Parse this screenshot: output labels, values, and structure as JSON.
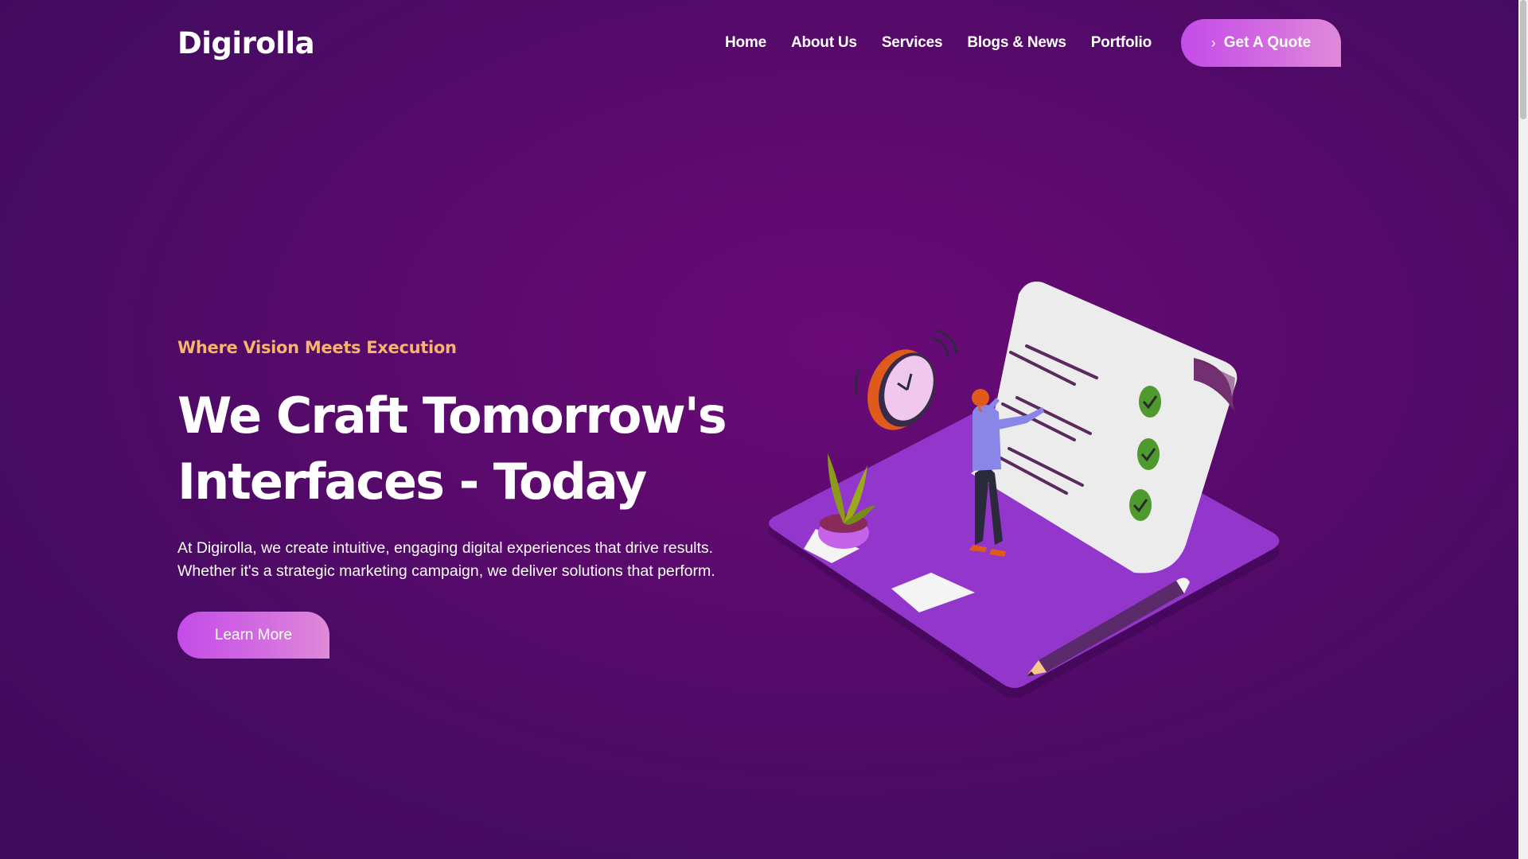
{
  "header": {
    "logo": "Digirolla",
    "nav": [
      "Home",
      "About Us",
      "Services",
      "Blogs & News",
      "Portfolio"
    ],
    "cta_label": "Get A Quote"
  },
  "hero": {
    "tagline": "Where Vision Meets Execution",
    "headline_line1": "We Craft Tomorrow's",
    "headline_line2": "Interfaces - Today",
    "description": "At Digirolla, we create intuitive, engaging digital experiences that drive results. Whether it's a strategic marketing campaign, we deliver solutions that perform.",
    "button_label": "Learn More"
  },
  "colors": {
    "background": "#5a0a6c",
    "accent_gradient_start": "#c44ce8",
    "accent_gradient_end": "#e08ad8",
    "tagline": "#f7b46a"
  },
  "icons": [
    "chevron-right-icon",
    "checklist-illustration"
  ]
}
